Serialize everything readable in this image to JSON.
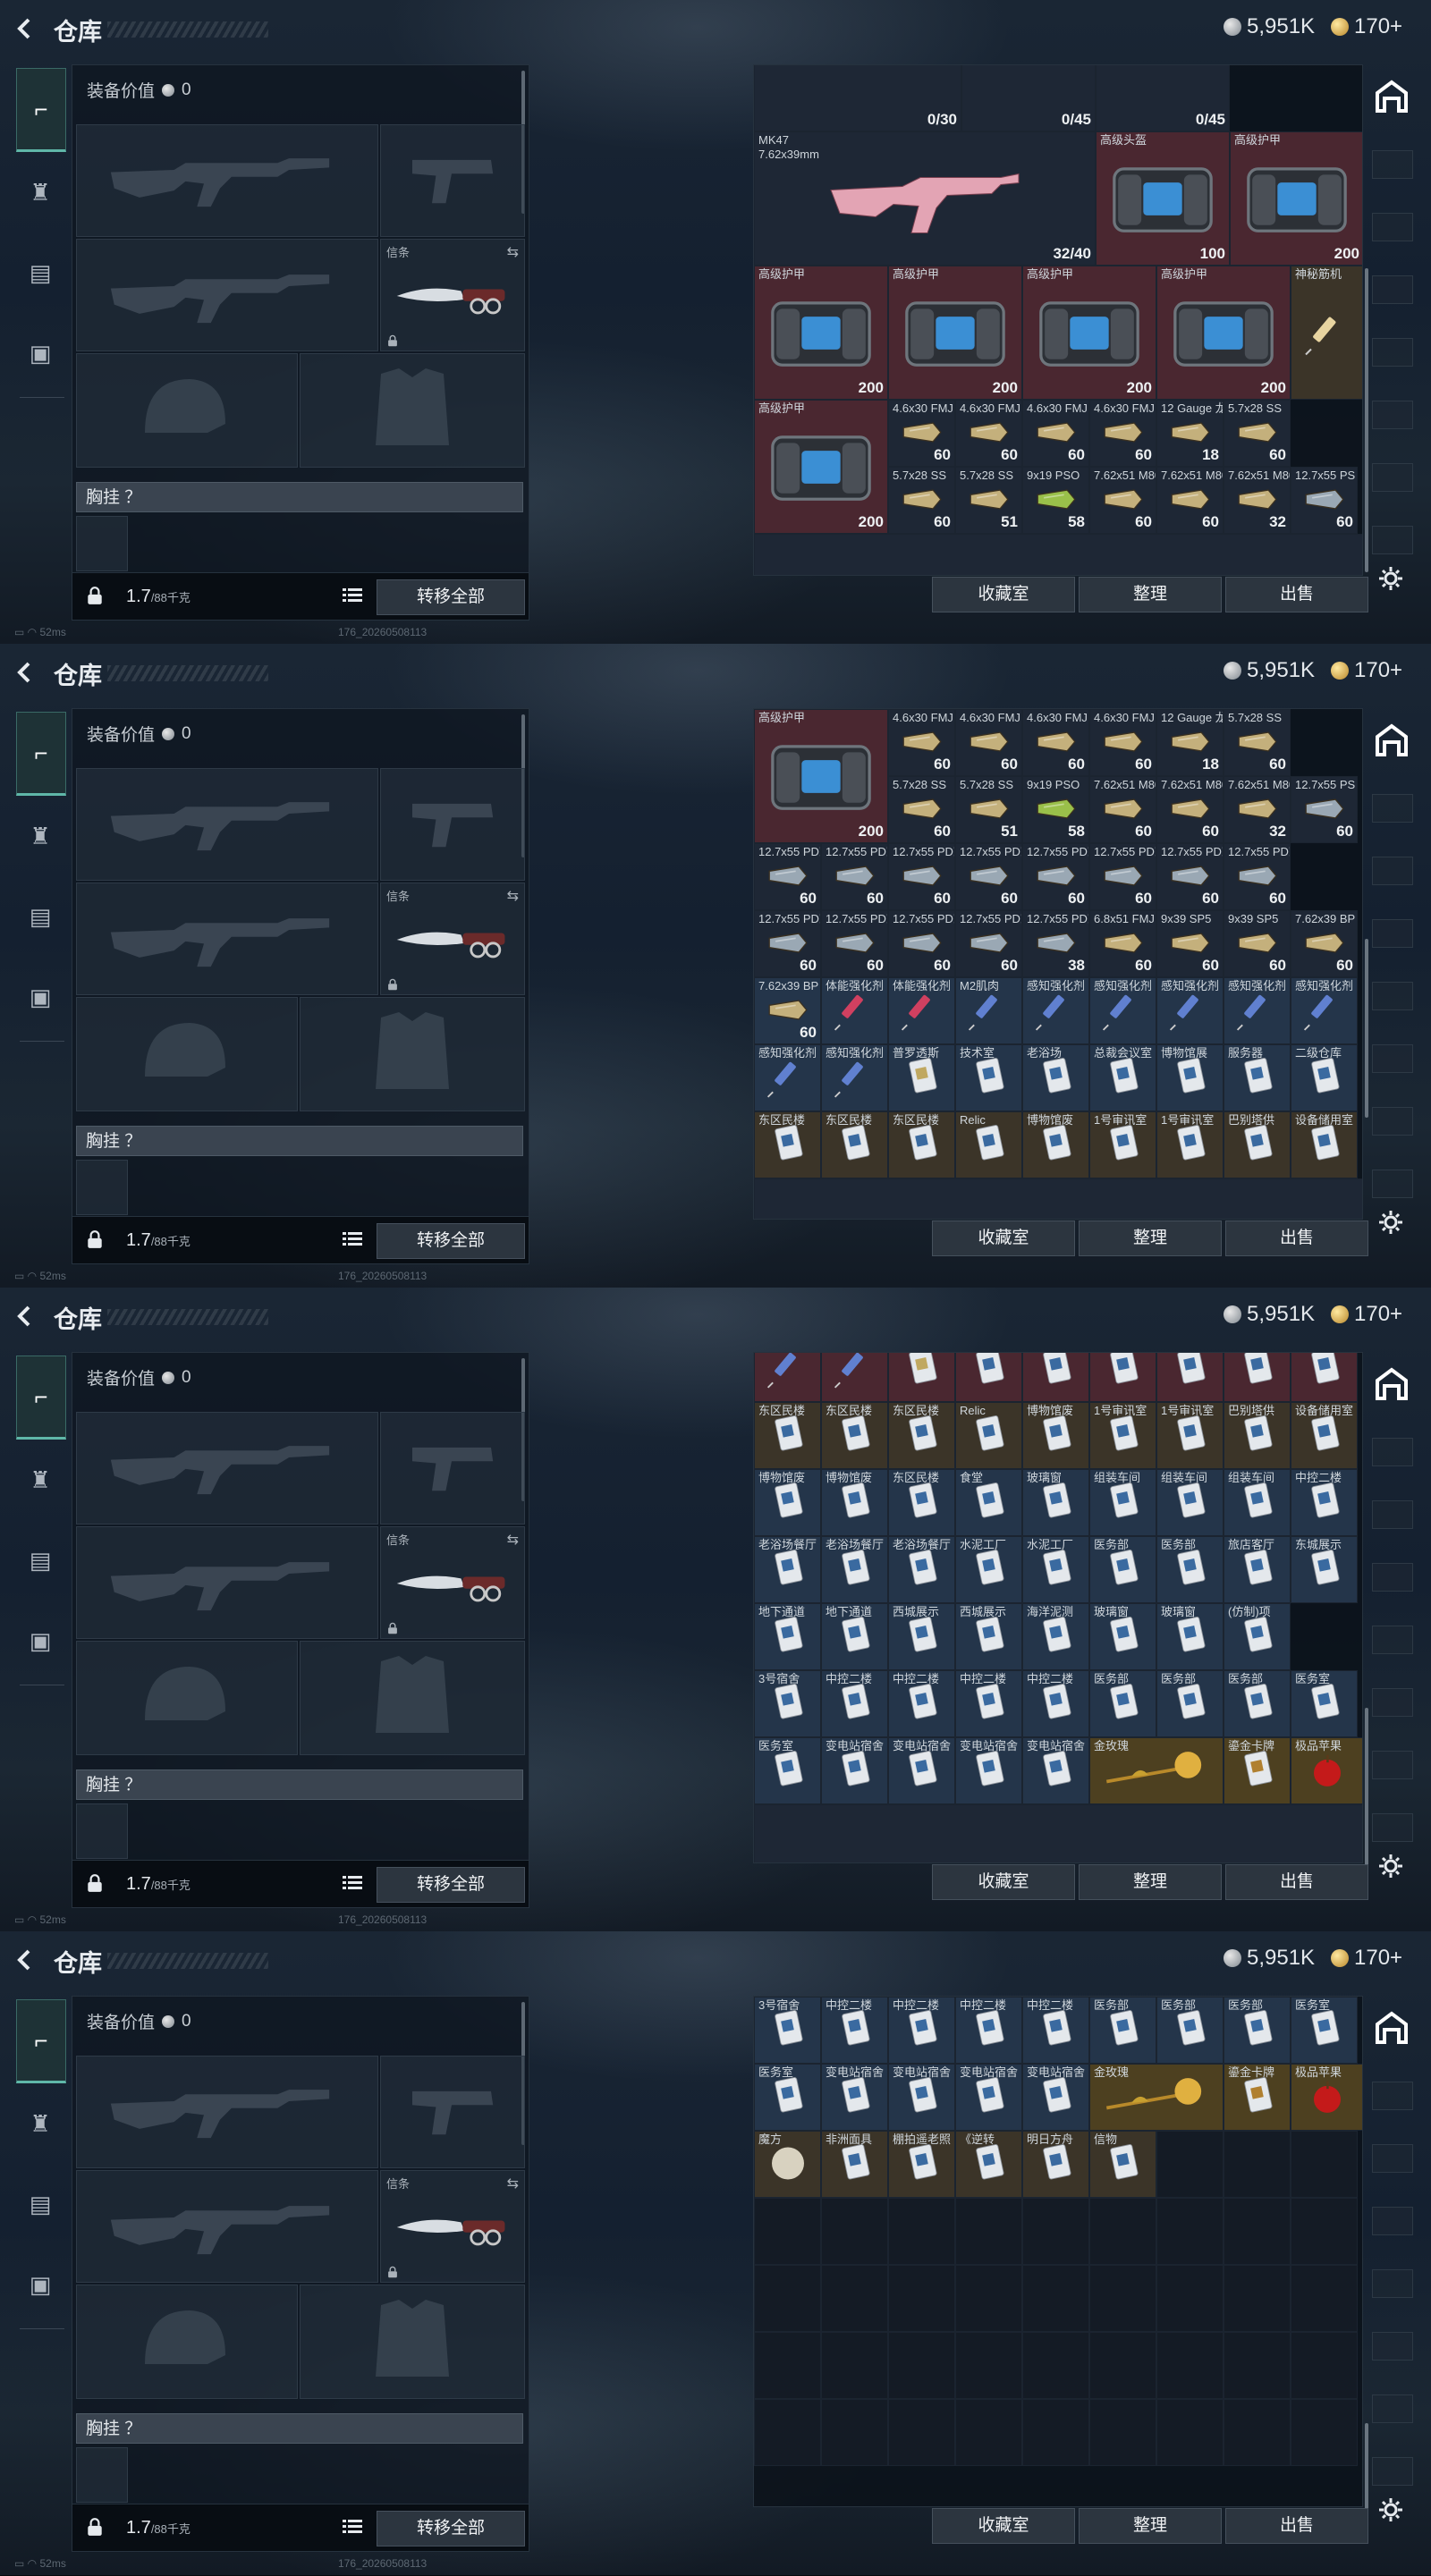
{
  "screens": [
    {
      "page_title": "仓库",
      "silver": "5,951K",
      "gold": "170+",
      "equip_value_label": "装备价值",
      "equip_value": "0",
      "secondary_slot_label": "信条",
      "chest_label": "胸挂 ？",
      "weight": "1.7",
      "weight_cap": "/88千克",
      "transfer_label": "转移全部",
      "ping": "52ms",
      "version": "176_20260508113"
    }
  ],
  "inventory_buttons": {
    "collection": "收藏室",
    "sort": "整理",
    "sell": "出售"
  },
  "screen1_cells": [
    {
      "name": "",
      "count": "0/30"
    },
    {
      "name": "",
      "count": "0/45"
    },
    {
      "name": "",
      "count": "0/45"
    },
    {
      "name": "MK47\n7.62x39mm",
      "count": "32/40"
    },
    {
      "name": "高级头盔",
      "count": "100"
    },
    {
      "name": "高级护甲",
      "count": "200"
    },
    {
      "name": "高级护甲",
      "count": "200"
    },
    {
      "name": "高级护甲",
      "count": "200"
    },
    {
      "name": "高级护甲",
      "count": "200"
    },
    {
      "name": "高级护甲",
      "count": "200"
    },
    {
      "name": "神秘筋机",
      "count": ""
    },
    {
      "name": "高级护甲",
      "count": "200"
    },
    {
      "name": "4.6x30 FMJ",
      "count": "60"
    },
    {
      "name": "4.6x30 FMJ",
      "count": "60"
    },
    {
      "name": "4.6x30 FMJ",
      "count": "60"
    },
    {
      "name": "4.6x30 FMJ",
      "count": "60"
    },
    {
      "name": "12 Gauge 龙息",
      "count": "18"
    },
    {
      "name": "5.7x28 SS",
      "count": "60"
    },
    {
      "name": "5.7x28 SS",
      "count": "60"
    },
    {
      "name": "5.7x28 SS",
      "count": "51"
    },
    {
      "name": "9x19 PSO",
      "count": "58"
    },
    {
      "name": "7.62x51 M80",
      "count": "60"
    },
    {
      "name": "7.62x51 M80",
      "count": "60"
    },
    {
      "name": "7.62x51 M80",
      "count": "32"
    },
    {
      "name": "12.7x55 PS",
      "count": "60"
    }
  ],
  "screen2_rows": [
    [
      "12.7x55 PD穿甲",
      "12.7x55 PD穿甲",
      "12.7x55 PD穿甲",
      "12.7x55 PD穿甲",
      "12.7x55 PD穿甲",
      "12.7x55 PD穿甲",
      "12.7x55 PD穿甲",
      "12.7x55 PD穿甲"
    ],
    [
      "12.7x55 PD穿甲",
      "12.7x55 PD穿甲",
      "12.7x55 PD穿甲",
      "12.7x55 PD穿甲",
      "12.7x55 PD穿甲",
      "6.8x51 FMJ",
      "9x39 SP5",
      "9x39 SP5",
      "7.62x39 BP"
    ],
    [
      "7.62x39 BP",
      "体能强化剂",
      "体能强化剂",
      "M2肌肉",
      "感知强化剂",
      "感知强化剂",
      "感知强化剂",
      "感知强化剂",
      "感知强化剂"
    ],
    [
      "感知强化剂",
      "感知强化剂",
      "普罗透斯",
      "技术室",
      "老浴场",
      "总裁会议室",
      "博物馆展",
      "服务器",
      "二级仓库"
    ],
    [
      "东区民楼",
      "东区民楼",
      "东区民楼",
      "Relic",
      "博物馆废",
      "1号审讯室",
      "1号审讯室",
      "巴别塔供",
      "设备储用室"
    ]
  ],
  "screen2_counts": [
    [
      "60",
      "60",
      "60",
      "60",
      "60",
      "60",
      "60",
      "60"
    ],
    [
      "60",
      "60",
      "60",
      "60",
      "38",
      "60",
      "60",
      "60",
      "60"
    ],
    [
      "60",
      "",
      "",
      "",
      "",
      "",
      "",
      "",
      ""
    ]
  ],
  "screen3_rows": [
    [
      "博物馆废",
      "博物馆废",
      "东区民楼",
      "食堂",
      "玻璃窗",
      "组装车间",
      "组装车间",
      "组装车间",
      "中控二楼"
    ],
    [
      "老浴场餐厅",
      "老浴场餐厅",
      "老浴场餐厅",
      "水泥工厂",
      "水泥工厂",
      "医务部",
      "医务部",
      "旅店客厅",
      "东城展示"
    ],
    [
      "地下通道",
      "地下通道",
      "西城展示",
      "西城展示",
      "海洋泥测",
      "玻璃窗",
      "玻璃窗",
      "(仿制)项"
    ],
    [
      "3号宿舍",
      "中控二楼",
      "中控二楼",
      "中控二楼",
      "中控二楼",
      "医务部",
      "医务部",
      "医务部",
      "医务室"
    ],
    [
      "医务室",
      "变电站宿舍",
      "变电站宿舍",
      "变电站宿舍",
      "变电站宿舍",
      "金玫瑰",
      "鎏金卡牌",
      "极品苹果"
    ]
  ],
  "screen4_rows": [
    [
      "魔方",
      "非洲面具",
      "棚拍遥老照",
      "《逆转",
      "明日方舟",
      "信物"
    ]
  ]
}
